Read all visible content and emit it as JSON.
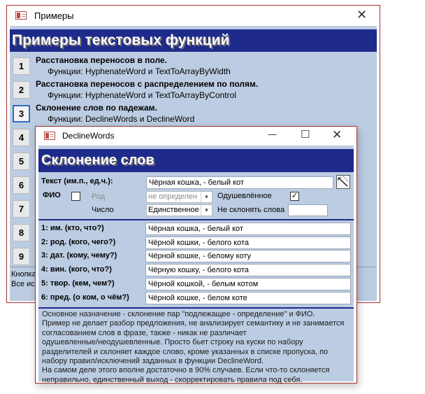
{
  "back_window": {
    "title": "Примеры",
    "close_glyph": "✕",
    "banner": "Примеры текстовых функций",
    "buttons": [
      "1",
      "2",
      "3",
      "4",
      "5",
      "6",
      "7",
      "8",
      "9"
    ],
    "examples": [
      {
        "title": "Расстановка переносов в поле.",
        "sub": "Функции: HyphenateWord и TextToArrayByWidth"
      },
      {
        "title": "Расстановка переносов с распределением по полям.",
        "sub": "Функции: HyphenateWord и TextToArrayByControl"
      },
      {
        "title": "Склонение слов по падежам.",
        "sub": "Функции: DeclineWords и DeclineWord"
      }
    ],
    "footer_line1": "Кнопка",
    "footer_line2": "Все ис"
  },
  "front_window": {
    "title": "DeclineWords",
    "minimize_glyph": "—",
    "maximize_glyph": "☐",
    "close_glyph": "✕",
    "banner": "Склонение слов",
    "text_label": "Текст (им.п., ед.ч.):",
    "text_value": "Чёрная кошка, - белый кот",
    "fio_label": "ФИО",
    "fio_checked": false,
    "rod_label": "Род",
    "rod_value": "не определен",
    "animate_label": "Одушевлённое",
    "animate_checked": true,
    "check_mark": "✓",
    "number_label": "Число",
    "number_value": "Единственное",
    "no_decline_label": "Не склонять слова",
    "no_decline_value": "",
    "cases": [
      {
        "label": "1: им. (кто, что?)",
        "value": "Чёрная кошка, - белый кот"
      },
      {
        "label": "2: род. (кого, чего?)",
        "value": "Чёрной кошки, - белого кота"
      },
      {
        "label": "3: дат. (кому, чему?)",
        "value": "Чёрной кошке, - белому коту"
      },
      {
        "label": "4: вин. (кого, что?)",
        "value": "Чёрную кошку, - белого кота"
      },
      {
        "label": "5: твор. (кем, чем?)",
        "value": "Чёрной кошкой, - белым котом"
      },
      {
        "label": "6: пред. (о ком, о чём?)",
        "value": "Чёрной кошке, - белом коте"
      }
    ],
    "description": [
      "Основное назначение - склонение пар \"подлежащее - определение\" и ФИО.",
      "Пример не делает разбор предложения, не анализирует семантику и не занимается",
      "согласованием слов в фразе, также - никак не различает",
      "одушевленные/неодушевленные. Просто бьет строку на куски по набору",
      "разделителей и склоняет каждое слово, кроме указанных в списке пропуска, по",
      "набору правил/исключений заданных в функции DeclineWord.",
      "На самом деле этого вполне достаточно в 90% случаев. Если что-то склоняется",
      "неправильно, единственный выход - скорректировать правила под себя."
    ]
  }
}
